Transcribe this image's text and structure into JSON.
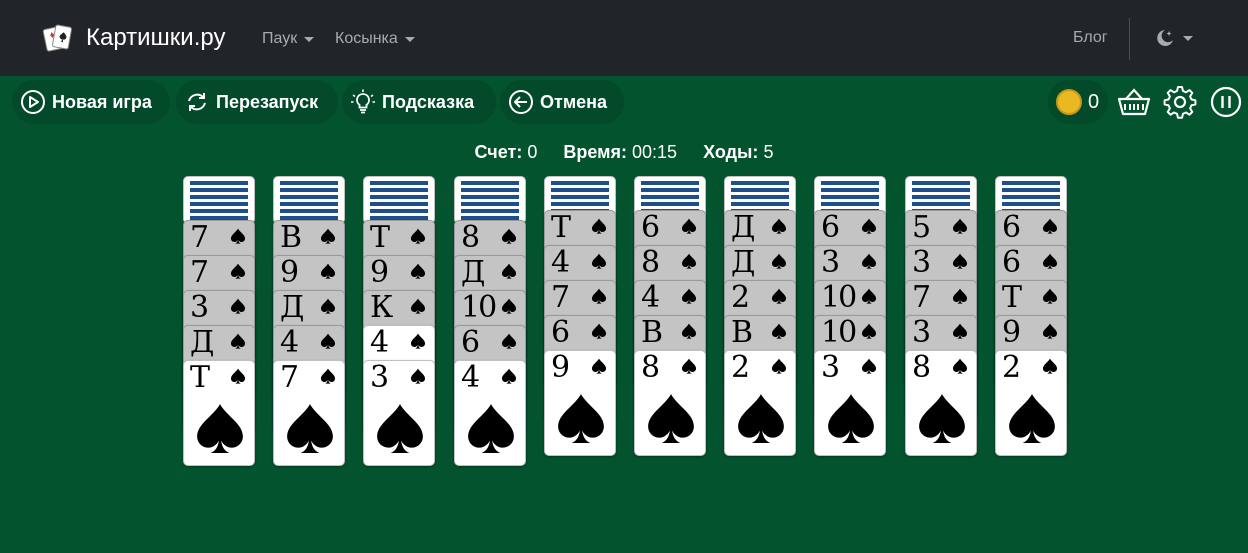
{
  "navbar": {
    "brand": "Картишки.ру",
    "menu": [
      {
        "label": "Паук"
      },
      {
        "label": "Косынка"
      }
    ],
    "blog": "Блог",
    "theme_icon": "moon-stars-icon",
    "bg_color": "#212529"
  },
  "toolbar": {
    "new_game": "Новая игра",
    "restart": "Перезапуск",
    "hint": "Подсказка",
    "undo": "Отмена",
    "coins": "0",
    "icons": [
      "play-circle-icon",
      "restart-icon",
      "lightbulb-icon",
      "arrow-left-circle-icon",
      "coin-icon",
      "basket-icon",
      "gear-icon",
      "pause-icon"
    ]
  },
  "stats": {
    "score_label": "Счет:",
    "score": "0",
    "time_label": "Время:",
    "time": "00:15",
    "moves_label": "Ходы:",
    "moves": "5"
  },
  "board": {
    "bg_color": "#03532f",
    "suit": "spades",
    "columns": [
      {
        "hidden": 1,
        "cards": [
          {
            "rank": "7",
            "face": "dim"
          },
          {
            "rank": "7",
            "face": "dim"
          },
          {
            "rank": "3",
            "face": "dim"
          },
          {
            "rank": "Д",
            "face": "dim"
          },
          {
            "rank": "Т",
            "face": "up"
          }
        ]
      },
      {
        "hidden": 1,
        "cards": [
          {
            "rank": "В",
            "face": "dim"
          },
          {
            "rank": "9",
            "face": "dim"
          },
          {
            "rank": "Д",
            "face": "dim"
          },
          {
            "rank": "4",
            "face": "dim"
          },
          {
            "rank": "7",
            "face": "up"
          }
        ]
      },
      {
        "hidden": 1,
        "cards": [
          {
            "rank": "Т",
            "face": "dim"
          },
          {
            "rank": "9",
            "face": "dim"
          },
          {
            "rank": "К",
            "face": "dim"
          },
          {
            "rank": "4",
            "face": "up"
          },
          {
            "rank": "3",
            "face": "up"
          }
        ]
      },
      {
        "hidden": 1,
        "cards": [
          {
            "rank": "8",
            "face": "dim"
          },
          {
            "rank": "Д",
            "face": "dim"
          },
          {
            "rank": "10",
            "face": "dim"
          },
          {
            "rank": "6",
            "face": "dim"
          },
          {
            "rank": "4",
            "face": "up"
          }
        ]
      },
      {
        "hidden": 1,
        "cards": [
          {
            "rank": "Т",
            "face": "dim"
          },
          {
            "rank": "4",
            "face": "dim"
          },
          {
            "rank": "7",
            "face": "dim"
          },
          {
            "rank": "6",
            "face": "dim"
          },
          {
            "rank": "9",
            "face": "up"
          }
        ]
      },
      {
        "hidden": 1,
        "cards": [
          {
            "rank": "6",
            "face": "dim"
          },
          {
            "rank": "8",
            "face": "dim"
          },
          {
            "rank": "4",
            "face": "dim"
          },
          {
            "rank": "В",
            "face": "dim"
          },
          {
            "rank": "8",
            "face": "up"
          }
        ]
      },
      {
        "hidden": 1,
        "cards": [
          {
            "rank": "Д",
            "face": "dim"
          },
          {
            "rank": "Д",
            "face": "dim"
          },
          {
            "rank": "2",
            "face": "dim"
          },
          {
            "rank": "В",
            "face": "dim"
          },
          {
            "rank": "2",
            "face": "up"
          }
        ]
      },
      {
        "hidden": 1,
        "cards": [
          {
            "rank": "6",
            "face": "dim"
          },
          {
            "rank": "3",
            "face": "dim"
          },
          {
            "rank": "10",
            "face": "dim"
          },
          {
            "rank": "10",
            "face": "dim"
          },
          {
            "rank": "3",
            "face": "up"
          }
        ]
      },
      {
        "hidden": 1,
        "cards": [
          {
            "rank": "5",
            "face": "dim"
          },
          {
            "rank": "3",
            "face": "dim"
          },
          {
            "rank": "7",
            "face": "dim"
          },
          {
            "rank": "3",
            "face": "dim"
          },
          {
            "rank": "8",
            "face": "up"
          }
        ]
      },
      {
        "hidden": 1,
        "cards": [
          {
            "rank": "6",
            "face": "dim"
          },
          {
            "rank": "6",
            "face": "dim"
          },
          {
            "rank": "Т",
            "face": "dim"
          },
          {
            "rank": "9",
            "face": "dim"
          },
          {
            "rank": "2",
            "face": "up"
          }
        ]
      }
    ]
  }
}
